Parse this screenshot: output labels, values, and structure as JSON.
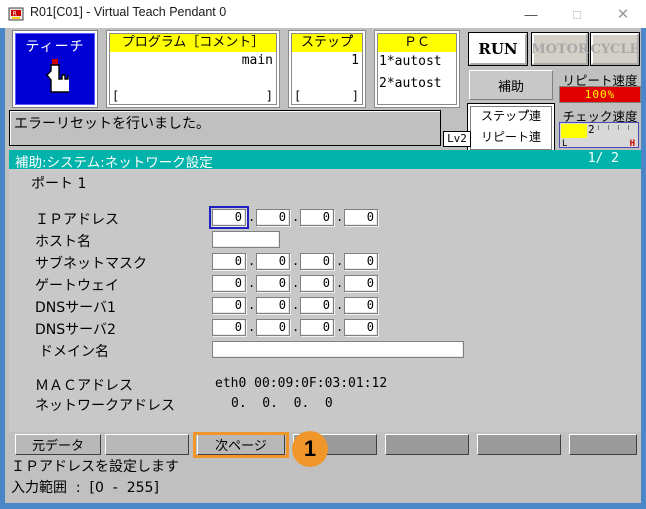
{
  "window": {
    "title": "R01[C01] - Virtual Teach Pendant 0",
    "app_icon": "robot-icon",
    "minimize": "—",
    "maximize": "□",
    "close": "✕"
  },
  "status_strip": {
    "teach_button": {
      "label": "ティーチ",
      "icon": "pointing-hand-icon",
      "active": true,
      "color": "#0000d4"
    },
    "program": {
      "caption": "プログラム［コメント］",
      "value": "main",
      "bracket_left": "[",
      "bracket_right": "]"
    },
    "step": {
      "caption": "ステップ゚",
      "value": "1",
      "bracket_left": "[",
      "bracket_right": "]"
    },
    "pc": {
      "caption": "ＰＣ",
      "line1": "1*autost",
      "line2": "2*autost"
    },
    "lamps": [
      {
        "label": "RUN",
        "on": true
      },
      {
        "label": "MOTOR",
        "on": false
      },
      {
        "label": "CYCLE",
        "on": false
      }
    ],
    "aux_button": "補助",
    "run_mode": {
      "line1": "ステップ゚連",
      "line2": "リピート連"
    },
    "repeat_speed": {
      "label": "リピート速度",
      "value": "100%",
      "bar_color": "#e00000",
      "text_color": "#ffff00"
    },
    "check_speed": {
      "label": "チェック速度",
      "value": "2",
      "low": "L",
      "high": "H",
      "fill_color": "#ffff00"
    }
  },
  "message": {
    "text": "エラーリセットを行いました。",
    "level_badge": "Lv2"
  },
  "section": {
    "title": "補助:システム:ネットワーク設定",
    "page": "1/  2",
    "bar_color": "#00b3ab"
  },
  "form": {
    "port_label": "ポート 1",
    "rows": [
      {
        "label": "ＩＰアドレス",
        "type": "octets",
        "values": [
          "0",
          "0",
          "0",
          "0"
        ],
        "focused_index": 0
      },
      {
        "label": "ホスト名",
        "type": "text",
        "value": ""
      },
      {
        "label": "サブネットマスク",
        "type": "octets",
        "values": [
          "0",
          "0",
          "0",
          "0"
        ],
        "focused_index": -1
      },
      {
        "label": "ゲートウェイ",
        "type": "octets",
        "values": [
          "0",
          "0",
          "0",
          "0"
        ],
        "focused_index": -1
      },
      {
        "label": "DNSサーバ1",
        "type": "octets",
        "values": [
          "0",
          "0",
          "0",
          "0"
        ],
        "focused_index": -1
      },
      {
        "label": "DNSサーバ2",
        "type": "octets",
        "values": [
          "0",
          "0",
          "0",
          "0"
        ],
        "focused_index": -1
      },
      {
        "label": "ドメイン名",
        "type": "text",
        "value": "",
        "indent": true
      }
    ],
    "separator": ".",
    "info": [
      {
        "label": "ＭＡＣアドレス",
        "value": "eth0 00:09:0F:03:01:12"
      },
      {
        "label": "ネットワークアドレス",
        "value": "0.  0.  0.  0"
      }
    ]
  },
  "function_keys": [
    {
      "label": "元データ",
      "lit": false
    },
    {
      "label": "",
      "lit": true
    },
    {
      "label": "次ページ",
      "lit": true,
      "highlighted": true
    },
    {
      "label": "",
      "lit": false
    },
    {
      "label": "",
      "lit": false
    },
    {
      "label": "",
      "lit": false
    },
    {
      "label": "",
      "lit": false
    }
  ],
  "annotation": {
    "marker_label": "1",
    "marker_color": "#f0962a"
  },
  "bottom_status": {
    "line1": "ＩＰアドレスを設定します",
    "line2": "入力範囲  :  [0  -  255]"
  }
}
